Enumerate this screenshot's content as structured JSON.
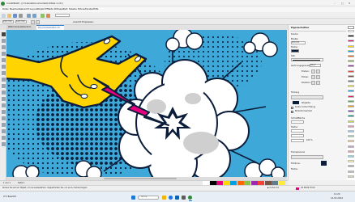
{
  "window": {
    "title": "CorelDRAW - [C:\\Users\\Documents\\Untitled-1.cdr]",
    "controls": [
      "–",
      "□",
      "✕"
    ]
  },
  "menu": [
    "Datei",
    "Bearbeiten",
    "Ansicht",
    "Layout",
    "Objekt",
    "Effekte",
    "Bitmaps",
    "Text",
    "Tabelle",
    "Extras",
    "Fenster",
    "Hilfe"
  ],
  "toolbar2": {
    "size_w": "24,0 mm",
    "size_h": "14,0 mm",
    "zoom": "Ansicht Einpassen"
  },
  "tabs": [
    {
      "label": "Willkommensbildschirm",
      "active": false
    },
    {
      "label": "Pop-Art-Illustration.cdr",
      "active": true
    }
  ],
  "docker": {
    "title": "Eigenschaften",
    "sections": [
      "Kontur",
      "Füllung",
      "Transparenz"
    ],
    "labels": [
      "Breite:",
      "Farbe:",
      "Stil:",
      "Gehrungsgrenze:",
      "Enden:",
      "Ecken:",
      "Position:",
      "Objekte",
      "Kontur hinter Füllung",
      "Bildschirmeinheit",
      "Schaltfläche",
      "Textur",
      "Fülllinie:",
      "Farbe:"
    ],
    "values": [
      "0,5 mm",
      "45,0 °",
      "100 %"
    ]
  },
  "canvas": {
    "background_color": "#3ea8d8",
    "artwork": "pop-art hand with lightning bolt and explosion cloud"
  },
  "palette_colors": [
    "#ffffff",
    "#000000",
    "#e6007e",
    "#ffd700",
    "#00a0e3",
    "#ff6600",
    "#8bc34a",
    "#9c27b0",
    "#f44336",
    "#795548",
    "#607d8b",
    "#ffeb3b",
    "#03a9f4",
    "#e91e63",
    "#4caf50",
    "#ff9800",
    "#673ab7",
    "#009688",
    "#cddc39",
    "#f48fb1",
    "#90caf9",
    "#a5d6a7",
    "#ffcc80",
    "#ce93d8",
    "#ef9a9a",
    "#80deea",
    "#fff59d",
    "#bcaaa4",
    "#b0bec5",
    "#c5e1a5"
  ],
  "status": {
    "left": "Klicken Sie auf ein Objekt, um es auszuwählen; doppelklicken Sie, um es zu drehen/neigen.",
    "fill_info": "C0 M100 Y0 K0",
    "coords": "▶ 0,152 mm"
  },
  "page_nav": {
    "page": "Seite 1",
    "counter": "1 von 1"
  },
  "taskbar": {
    "time": "11:24",
    "date": "14.03.2024",
    "weather": "9°C Bewölkt",
    "search": "Suche"
  }
}
